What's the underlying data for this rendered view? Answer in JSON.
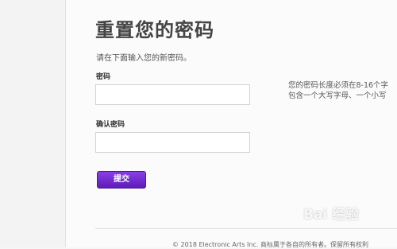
{
  "page": {
    "title": "重置您的密码",
    "subtitle": "请在下面输入您的新密码。"
  },
  "form": {
    "password_label": "密码",
    "password_value": "",
    "confirm_label": "确认密码",
    "confirm_value": "",
    "submit_label": "提交",
    "hint_line1": "您的密码长度必须在8-16个字",
    "hint_line2": "包含一个大写字母、一个小写"
  },
  "footer": {
    "copyright": "© 2018 Electronic Arts Inc. 商标属于各自的所有者。保留所有权利"
  },
  "watermark": {
    "text": "Bai 经验"
  },
  "colors": {
    "submit_button": "#6a2bd1",
    "background": "#f6f6f6"
  }
}
